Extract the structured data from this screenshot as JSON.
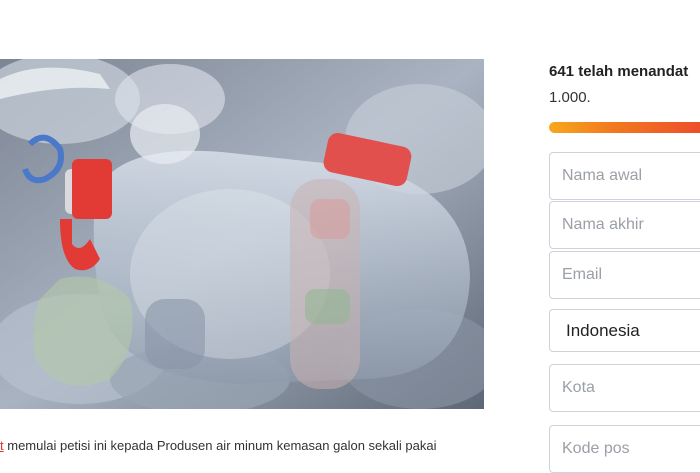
{
  "campaign": {
    "caption_lead": "t",
    "caption_rest": " memulai petisi ini kepada Produsen air minum kemasan galon sekali pakai"
  },
  "signatures": {
    "count_text": "641 telah menandat",
    "goal_text": "1.000."
  },
  "form": {
    "first_name_placeholder": "Nama awal",
    "last_name_placeholder": "Nama akhir",
    "email_placeholder": "Email",
    "country_value": "Indonesia",
    "city_placeholder": "Kota",
    "postcode_placeholder": "Kode pos"
  },
  "colors": {
    "progress_start": "#f7a81c",
    "progress_end": "#ec4f2a",
    "link_red": "#e0332b"
  }
}
